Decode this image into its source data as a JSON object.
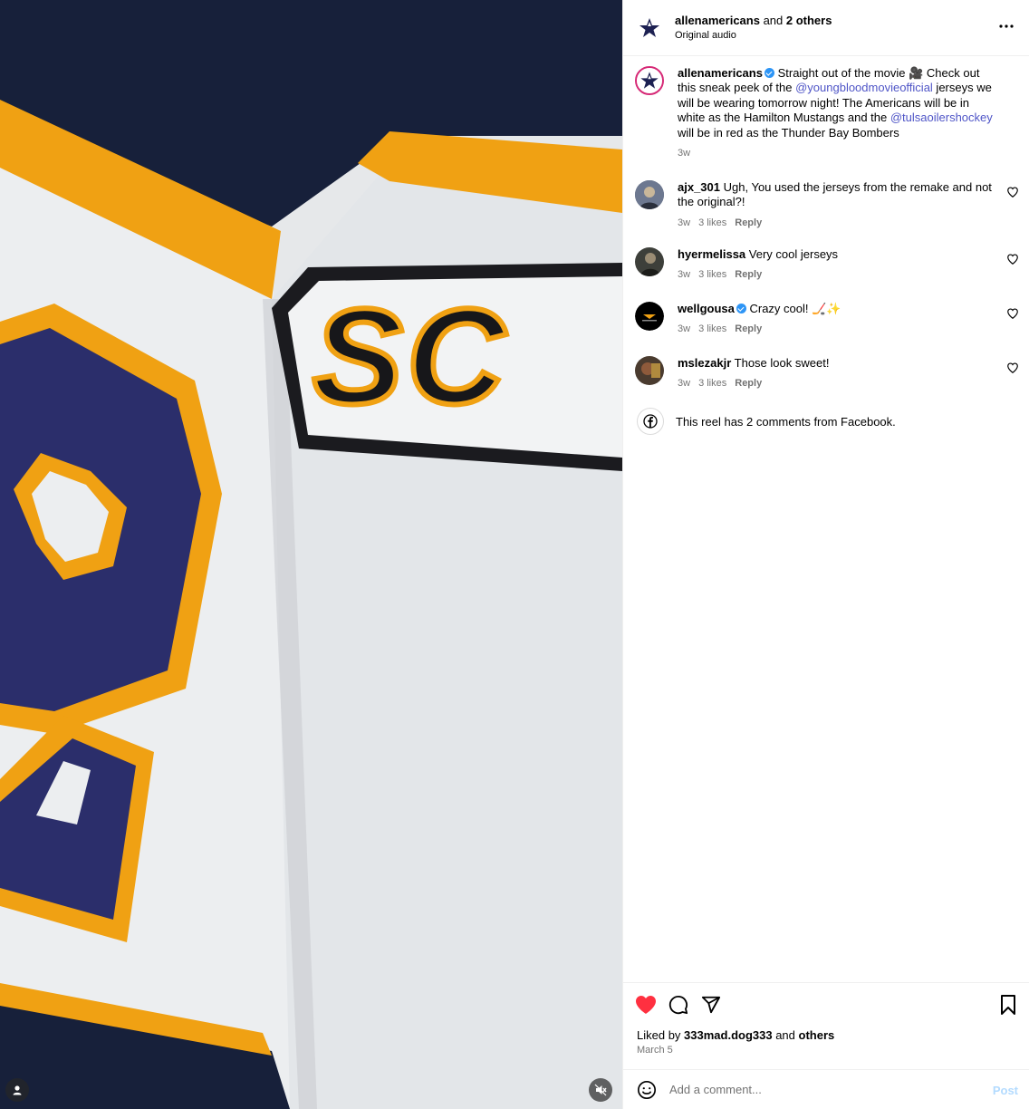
{
  "header": {
    "author": "allenamericans",
    "joiner": " and ",
    "others": "2 others",
    "audio": "Original audio",
    "more_icon": "more-horizontal-icon"
  },
  "caption": {
    "user": "allenamericans",
    "text_1": "Straight out of the movie 🎥 Check out this sneak peek of the ",
    "mention_1": "@youngbloodmovieofficial",
    "text_2": " jerseys we will be wearing tomorrow night! The Americans will be in white as the Hamilton Mustangs and the ",
    "mention_2": "@tulsaoilershockey",
    "text_3": " will be in red as the Thunder Bay Bombers",
    "time": "3w"
  },
  "comments": [
    {
      "user": "ajx_301",
      "verified": false,
      "text": "Ugh, You used the jerseys from the remake and not the original?!",
      "time": "3w",
      "likes": "3 likes",
      "reply": "Reply"
    },
    {
      "user": "hyermelissa",
      "verified": false,
      "text": "Very cool jerseys",
      "time": "3w",
      "likes": "3 likes",
      "reply": "Reply"
    },
    {
      "user": "wellgousa",
      "verified": true,
      "text": "Crazy cool! 🏒✨",
      "time": "3w",
      "likes": "3 likes",
      "reply": "Reply"
    },
    {
      "user": "mslezakjr",
      "verified": false,
      "text": "Those look sweet!",
      "time": "3w",
      "likes": "3 likes",
      "reply": "Reply"
    }
  ],
  "facebook_note": "This reel has 2 comments from Facebook.",
  "actions": {
    "liked_by_prefix": "Liked by ",
    "liked_by_user": "333mad.dog333",
    "liked_by_joiner": " and ",
    "liked_by_others": "others",
    "date": "March 5",
    "like_color": "#ff3040"
  },
  "composer": {
    "placeholder": "Add a comment...",
    "post_label": "Post"
  },
  "media": {
    "jersey_lettering": "SC"
  }
}
